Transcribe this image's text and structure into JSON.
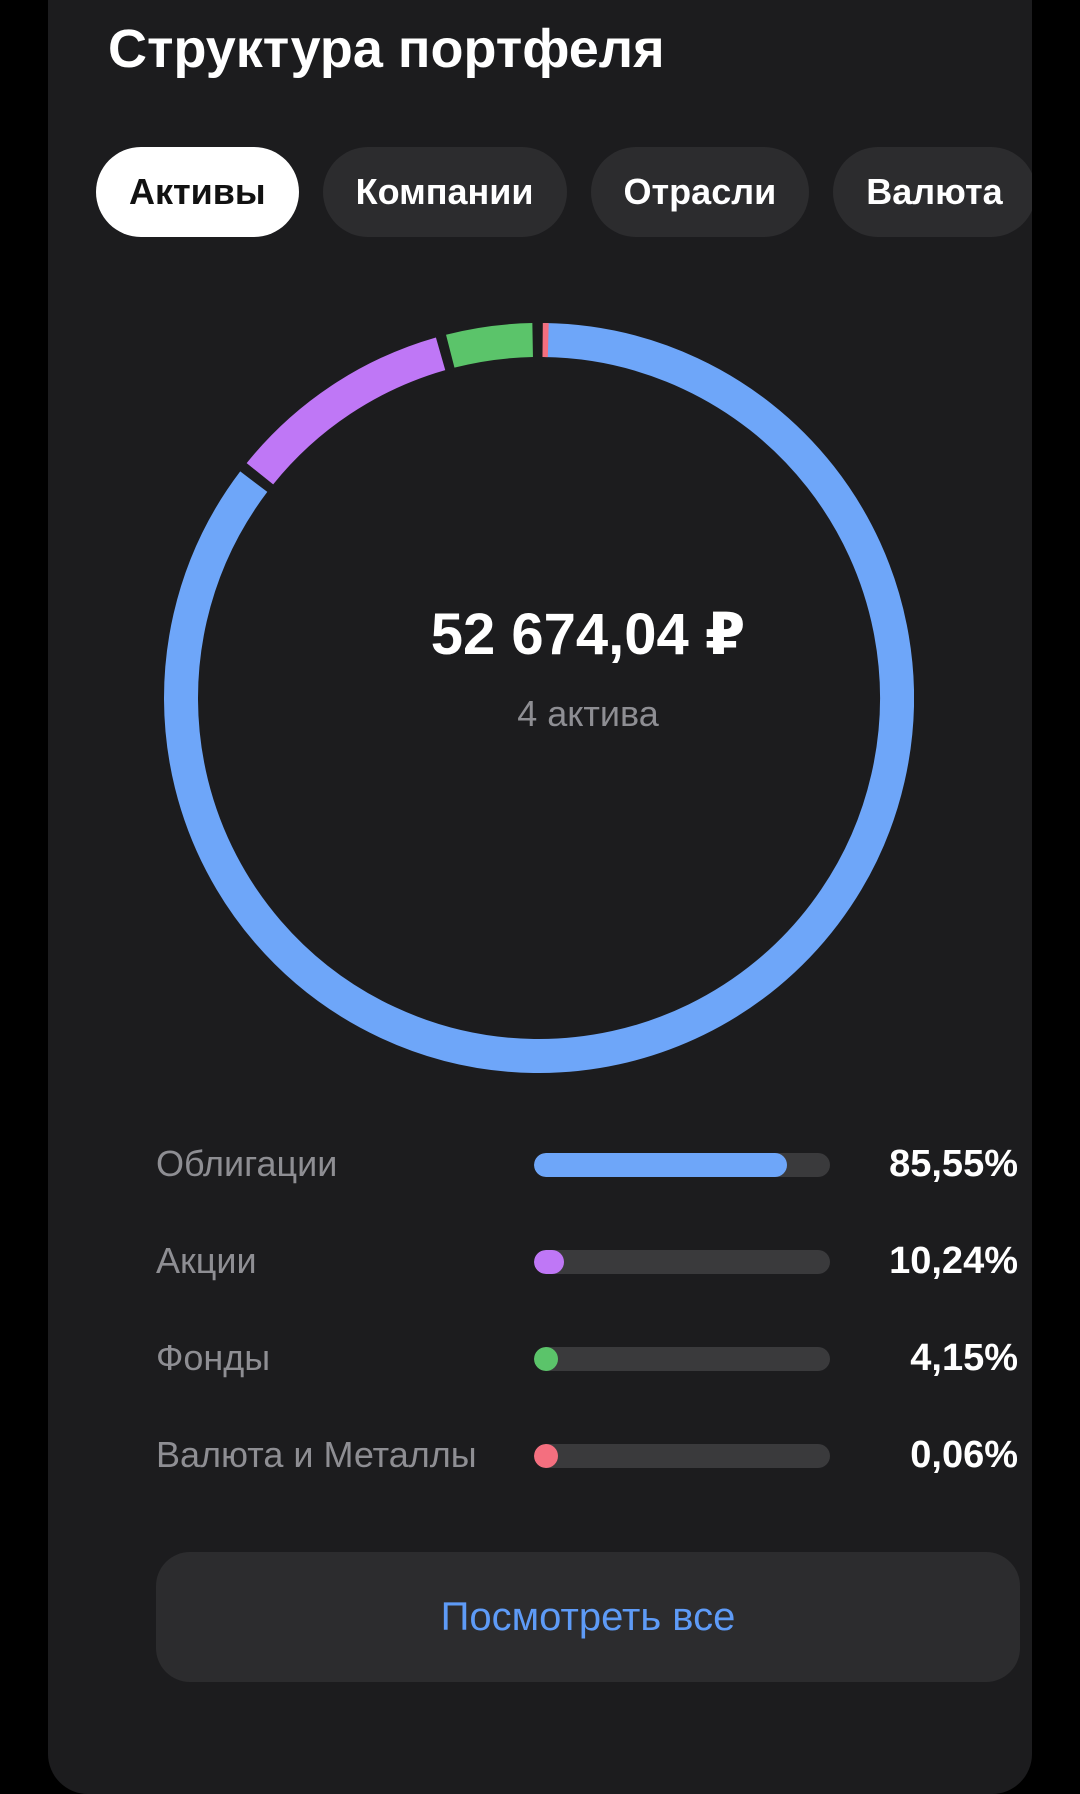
{
  "header": {
    "title": "Структура портфеля"
  },
  "tabs": [
    {
      "label": "Активы",
      "active": true
    },
    {
      "label": "Компании",
      "active": false
    },
    {
      "label": "Отрасли",
      "active": false
    },
    {
      "label": "Валюта",
      "active": false
    }
  ],
  "summary": {
    "total": "52 674,04 ₽",
    "count": "4 актива"
  },
  "legend": [
    {
      "label": "Облигации",
      "value": "85,55%"
    },
    {
      "label": "Акции",
      "value": "10,24%"
    },
    {
      "label": "Фонды",
      "value": "4,15%"
    },
    {
      "label": "Валюта и Металлы",
      "value": "0,06%"
    }
  ],
  "actions": {
    "view_all_label": "Посмотреть все"
  },
  "chart_data": {
    "type": "pie",
    "categories": [
      "Облигации",
      "Акции",
      "Фонды",
      "Валюта и Металлы"
    ],
    "values": [
      85.55,
      10.24,
      4.15,
      0.06
    ],
    "colors": [
      "#6ea6f9",
      "#bf77f6",
      "#5bc46a",
      "#f46f7f"
    ],
    "track_color": "#3a3a3c",
    "donut": true
  }
}
